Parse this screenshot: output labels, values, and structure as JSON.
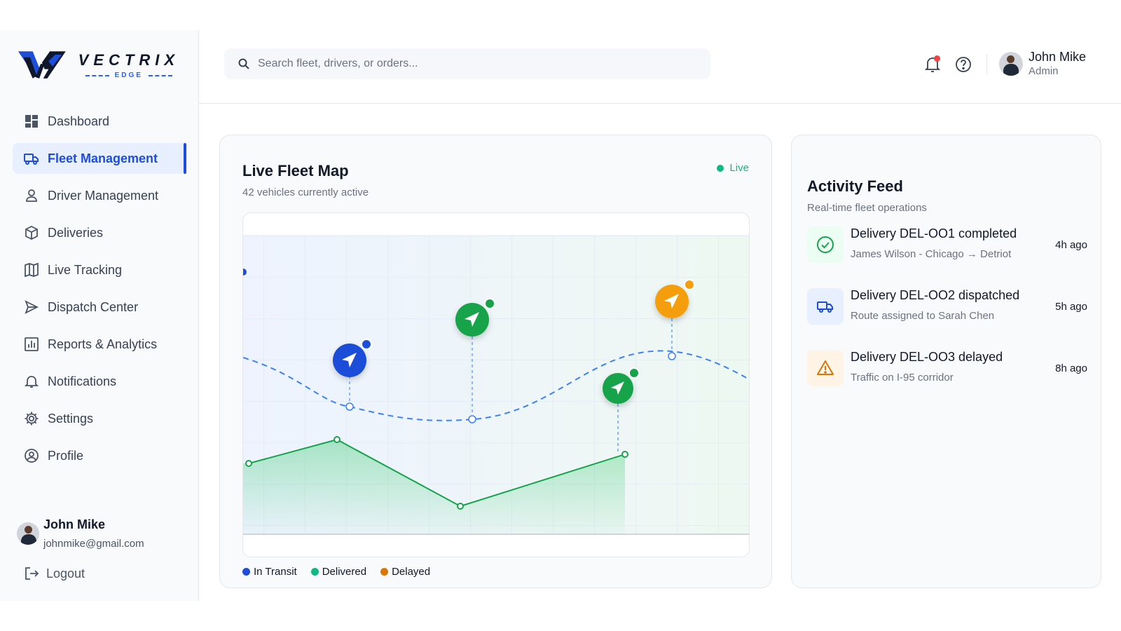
{
  "brand": {
    "name": "VECTRIX",
    "sub": "EDGE"
  },
  "sidebar": {
    "items": [
      {
        "label": "Dashboard",
        "icon": "dashboard-icon"
      },
      {
        "label": "Fleet Management",
        "icon": "truck-icon",
        "active": true
      },
      {
        "label": "Driver Management",
        "icon": "user-icon"
      },
      {
        "label": "Deliveries",
        "icon": "package-icon"
      },
      {
        "label": "Live Tracking",
        "icon": "map-icon"
      },
      {
        "label": "Dispatch Center",
        "icon": "send-icon"
      },
      {
        "label": "Reports & Analytics",
        "icon": "chart-icon"
      },
      {
        "label": "Notifications",
        "icon": "bell-icon"
      },
      {
        "label": "Settings",
        "icon": "gear-icon"
      },
      {
        "label": "Profile",
        "icon": "profile-icon"
      }
    ],
    "user": {
      "name": "John Mike",
      "email": "johnmike@gmail.com"
    },
    "logout": "Logout"
  },
  "topbar": {
    "search_placeholder": "Search fleet, drivers, or orders...",
    "user": {
      "name": "John Mike",
      "role": "Admin"
    }
  },
  "map": {
    "title": "Live Fleet Map",
    "subtitle": "42 vehicles currently active",
    "live_label": "Live",
    "legend": [
      {
        "label": "In Transit",
        "color": "#1d4ed8"
      },
      {
        "label": "Delivered",
        "color": "#10b981"
      },
      {
        "label": "Delayed",
        "color": "#d97706"
      }
    ]
  },
  "activity": {
    "title": "Activity Feed",
    "subtitle": "Real-time fleet operations",
    "items": [
      {
        "title": "Delivery DEL-OO1 completed",
        "desc": "James Wilson - Chicago → Detriot",
        "time": "4h ago",
        "icon": "check-circle-icon",
        "status": "completed"
      },
      {
        "title": "Delivery DEL-OO2 dispatched",
        "desc": "Route assigned to Sarah Chen",
        "time": "5h ago",
        "icon": "truck-icon",
        "status": "dispatched"
      },
      {
        "title": "Delivery DEL-OO3 delayed",
        "desc": "Traffic on I-95 corridor",
        "time": "8h ago",
        "icon": "warning-icon",
        "status": "delayed"
      }
    ]
  },
  "colors": {
    "accent": "#1d4ed8",
    "delivered": "#16a34a",
    "delayed": "#f59e0b",
    "alert": "#ef4444"
  }
}
